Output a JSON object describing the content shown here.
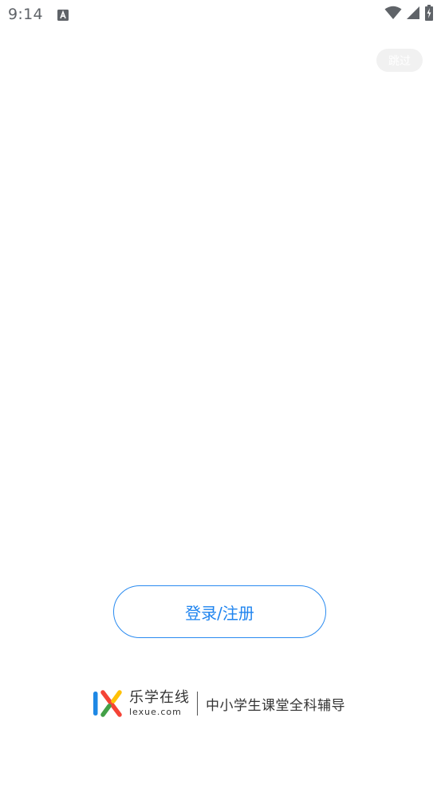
{
  "status_bar": {
    "time": "9:14",
    "icons": [
      "notification-a-icon",
      "wifi-icon",
      "cell-signal-icon",
      "battery-charging-icon"
    ]
  },
  "skip_label": "跳过",
  "login_label": "登录/注册",
  "brand": {
    "name": "乐学在线",
    "domain": "lexue.com",
    "slogan": "中小学生课堂全科辅导",
    "colors": {
      "blue": "#1e88e5",
      "red": "#f44336",
      "yellow": "#ffc107",
      "green": "#43a047"
    }
  },
  "colors": {
    "accent": "#1f84ef",
    "status_icon": "#5f6368",
    "skip_bg": "#f1f1f1"
  }
}
